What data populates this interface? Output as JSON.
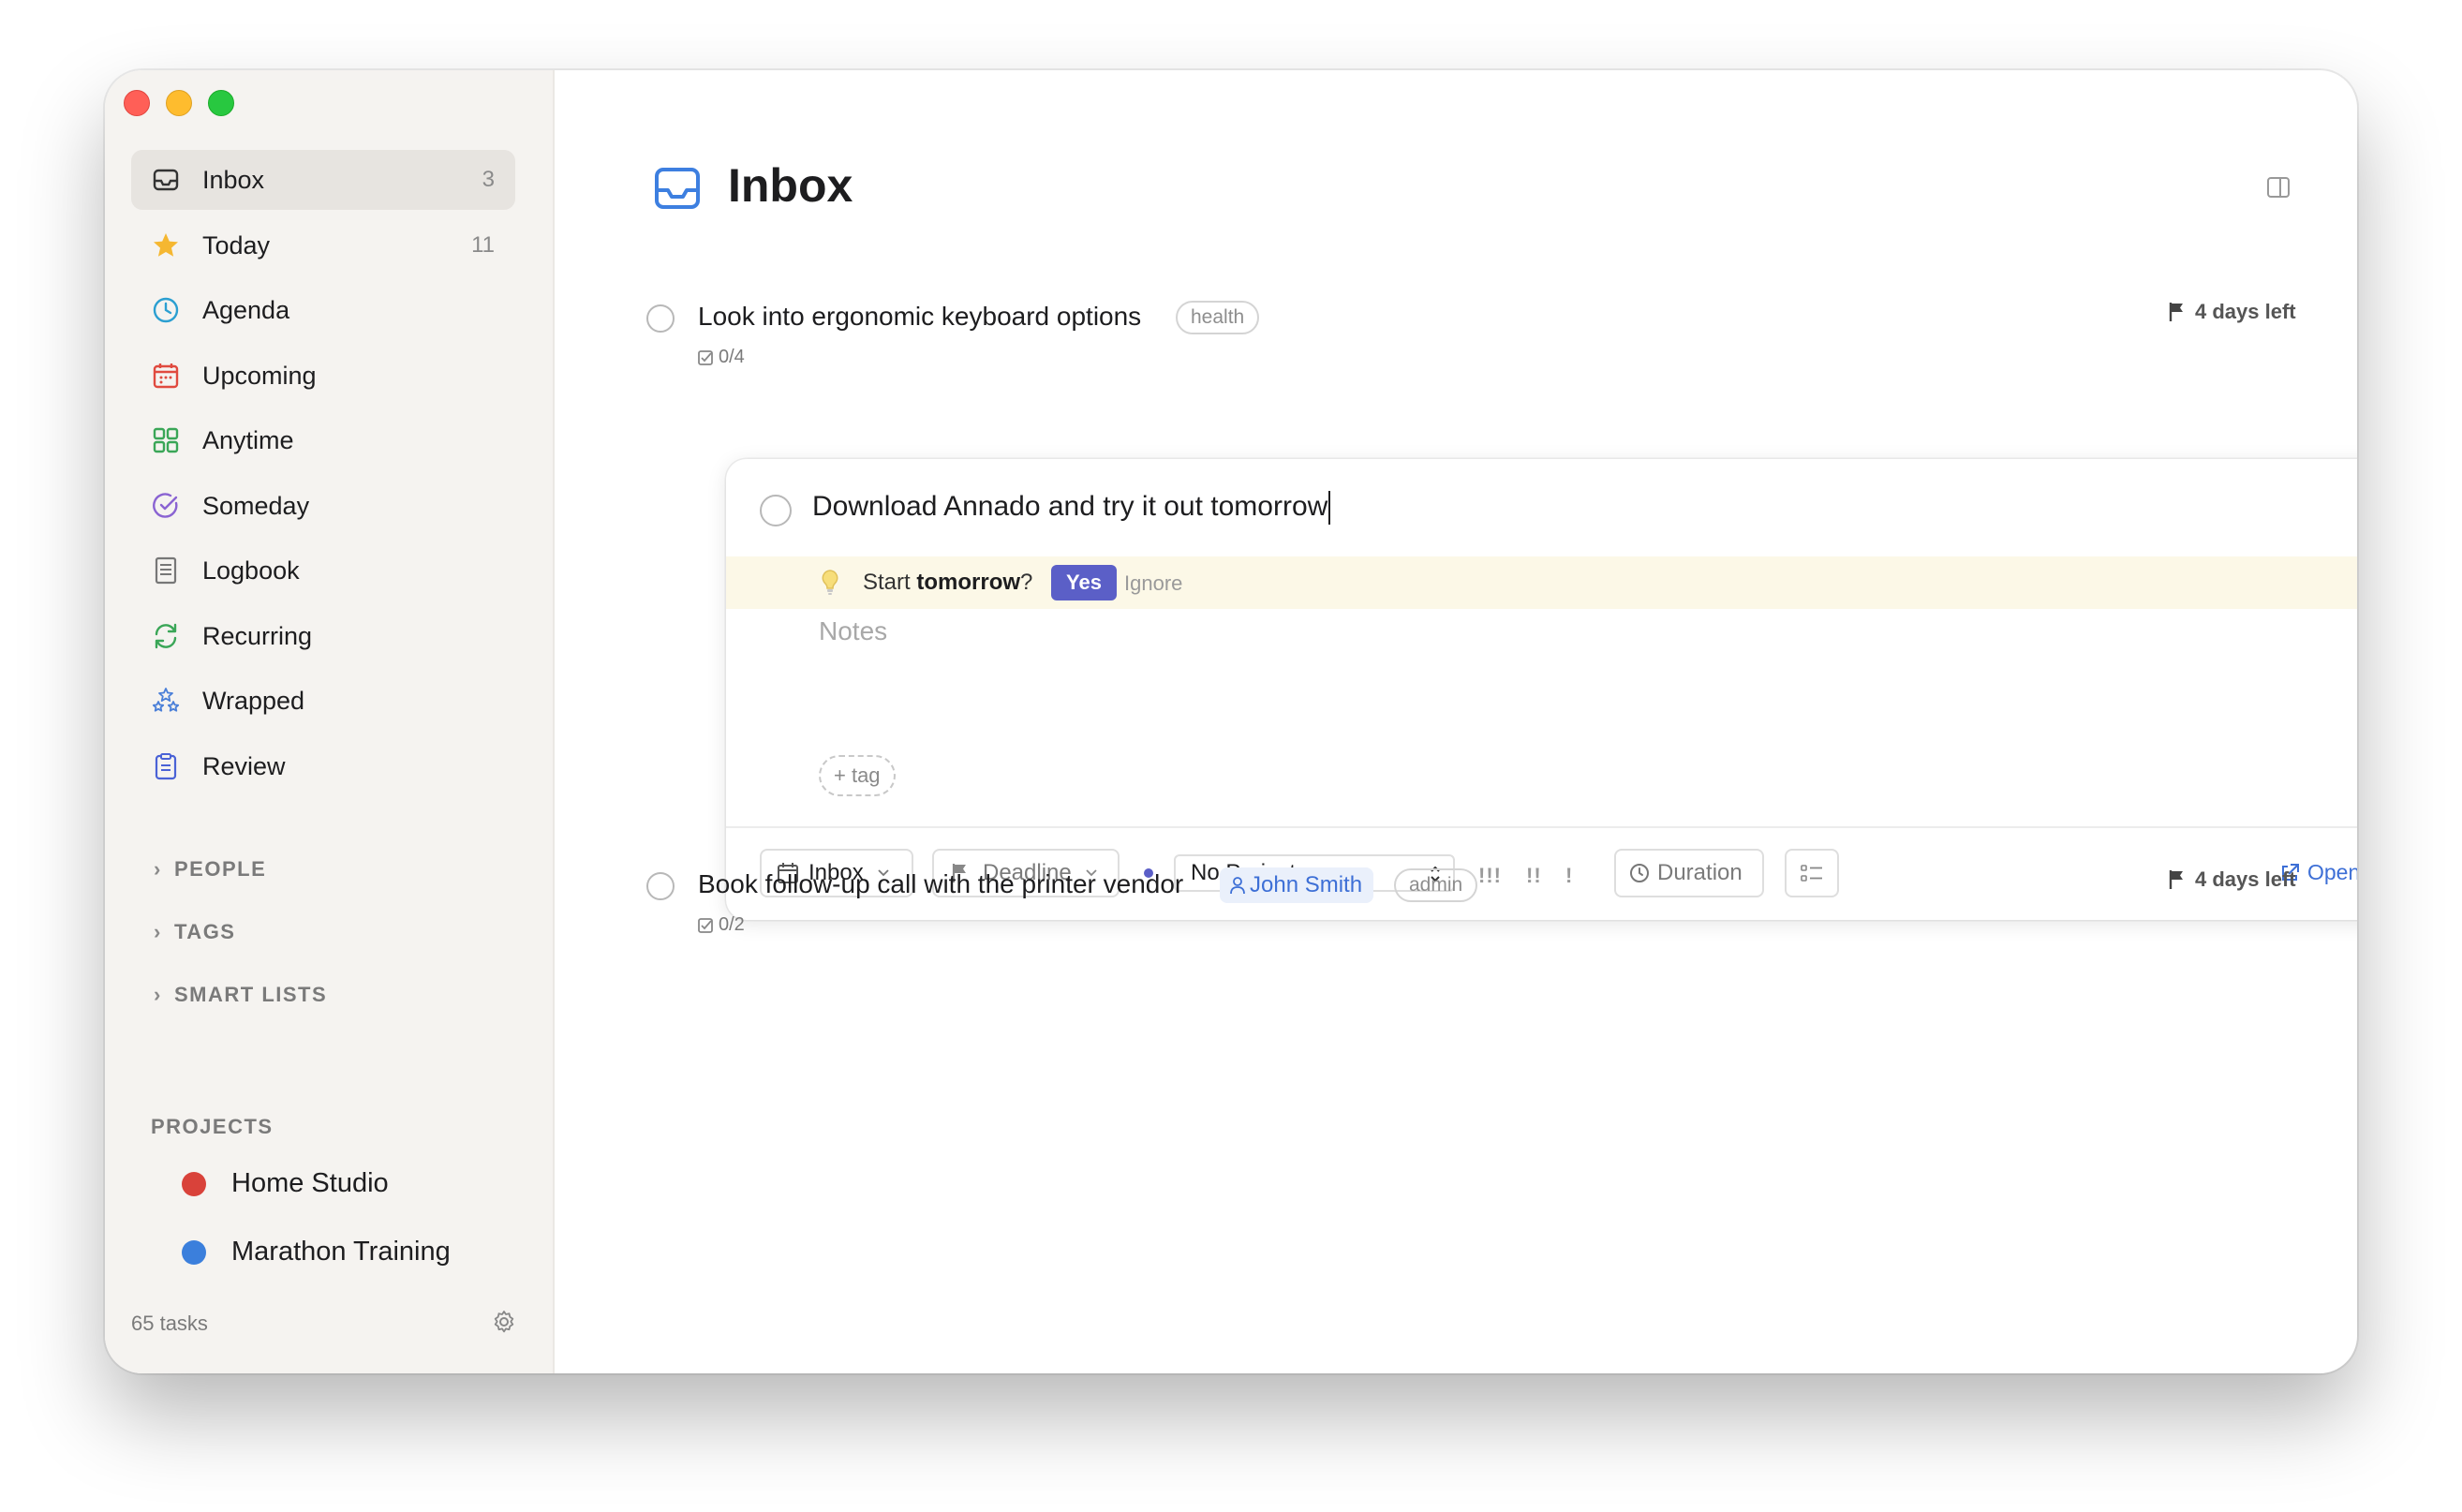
{
  "sidebar": {
    "items": [
      {
        "label": "Inbox",
        "count": "3",
        "icon": "inbox-icon",
        "active": true
      },
      {
        "label": "Today",
        "count": "11",
        "icon": "star-icon"
      },
      {
        "label": "Agenda",
        "count": "",
        "icon": "clock-icon"
      },
      {
        "label": "Upcoming",
        "count": "",
        "icon": "calendar-icon"
      },
      {
        "label": "Anytime",
        "count": "",
        "icon": "grid-icon"
      },
      {
        "label": "Someday",
        "count": "",
        "icon": "arc-check-icon"
      },
      {
        "label": "Logbook",
        "count": "",
        "icon": "book-icon"
      },
      {
        "label": "Recurring",
        "count": "",
        "icon": "repeat-icon"
      },
      {
        "label": "Wrapped",
        "count": "",
        "icon": "stars-icon"
      },
      {
        "label": "Review",
        "count": "",
        "icon": "clipboard-icon"
      }
    ],
    "sections": [
      "PEOPLE",
      "TAGS",
      "SMART LISTS"
    ],
    "projects_heading": "PROJECTS",
    "projects": [
      {
        "name": "Home Studio",
        "color": "#d9423a"
      },
      {
        "name": "Marathon Training",
        "color": "#3b7fdc"
      }
    ],
    "footer_count": "65 tasks"
  },
  "main": {
    "title": "Inbox",
    "tasks": [
      {
        "title": "Look into ergonomic keyboard options",
        "tag": "health",
        "subtasks": "0/4",
        "deadline": "4 days left"
      },
      {
        "title": "Book follow-up call with the printer vendor",
        "person": "John Smith",
        "tag": "admin",
        "subtasks": "0/2",
        "deadline": "4 days left"
      }
    ],
    "editing": {
      "title": "Download Annado and try it out tomorrow",
      "suggestion_prefix": "Start ",
      "suggestion_word": "tomorrow",
      "suggestion_suffix": "?",
      "yes_label": "Yes",
      "ignore_label": "Ignore",
      "notes_placeholder": "Notes",
      "add_tag_label": "+ tag",
      "toolbar": {
        "list_label": "Inbox",
        "deadline_label": "Deadline",
        "project_label": "No Project",
        "priority_high": "!!!",
        "priority_medium": "!!",
        "priority_low": "!",
        "duration_label": "Duration",
        "open_file_label": "Open file"
      }
    }
  },
  "colors": {
    "accent": "#5b5fc7",
    "link": "#3d6fd6",
    "today_star": "#f5b731",
    "suggestion_bg": "#fcf8e7"
  }
}
